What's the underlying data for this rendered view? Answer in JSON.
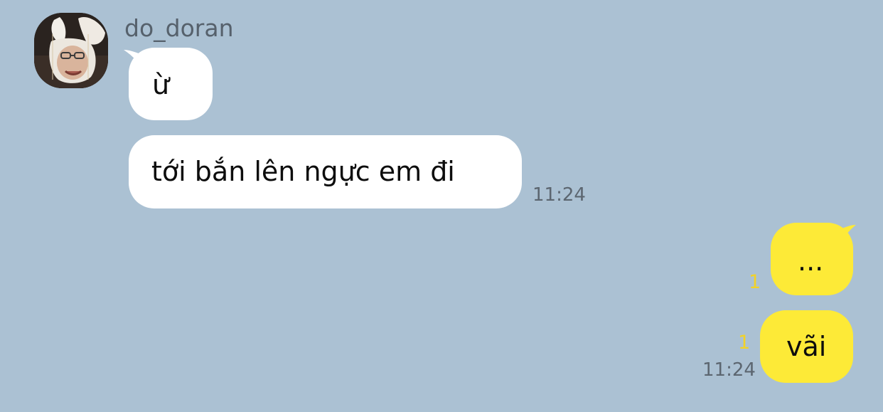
{
  "conversation": {
    "sender": {
      "name": "do_doran",
      "avatar": "profile-photo"
    },
    "incoming": [
      {
        "text": "ừ"
      },
      {
        "text": "tới bắn lên ngực em đi",
        "time": "11:24"
      }
    ],
    "outgoing": [
      {
        "text": "...",
        "unread": "1"
      },
      {
        "text": "vãi",
        "unread": "1",
        "time": "11:24"
      }
    ]
  },
  "colors": {
    "background": "#abc1d3",
    "incoming_bubble": "#ffffff",
    "outgoing_bubble": "#fdea37",
    "unread_count": "#f2d227",
    "timestamp": "#5c6670",
    "sender_name": "#56616c"
  }
}
